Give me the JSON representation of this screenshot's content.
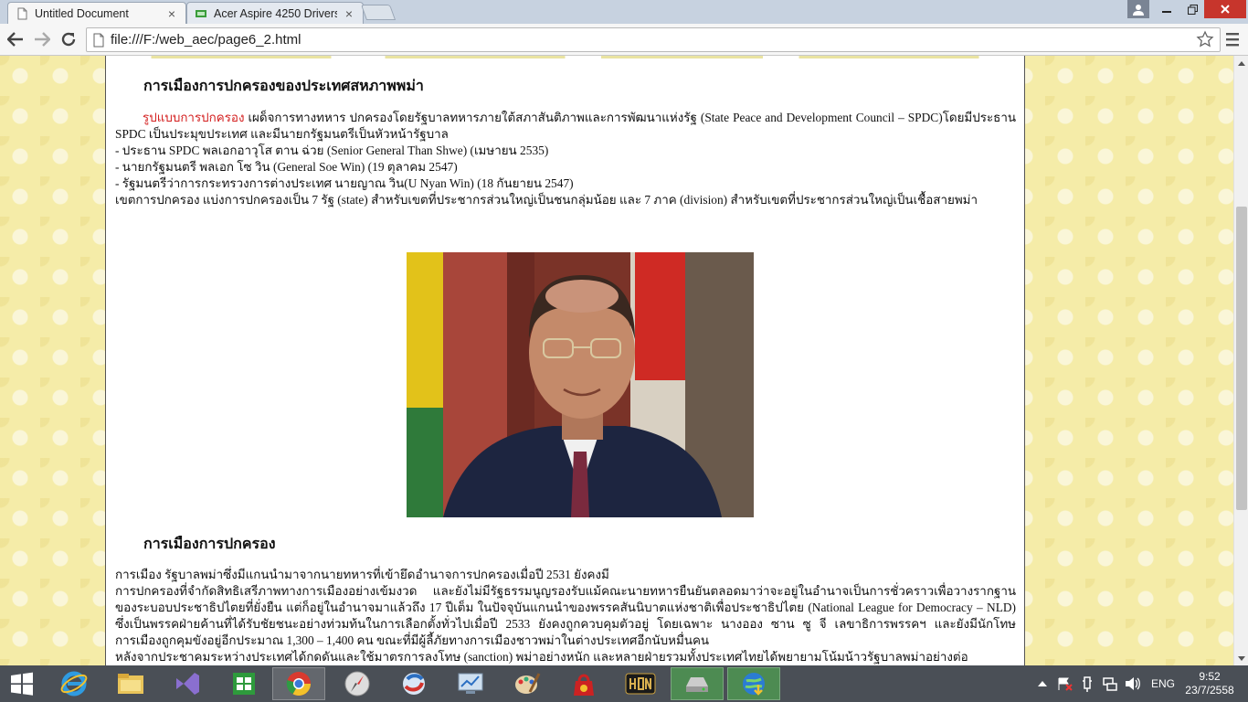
{
  "browser": {
    "tabs": [
      {
        "title": "Untitled Document",
        "active": true
      },
      {
        "title": "Acer Aspire 4250 Drivers D",
        "active": false
      }
    ],
    "url": "file:///F:/web_aec/page6_2.html"
  },
  "page": {
    "heading1": "การเมืองการปกครองของประเทศสหภาพพม่า",
    "gov_label": "รูปแบบการปกครอง",
    "gov_text": "เผด็จการทางทหาร ปกครองโดยรัฐบาลทหารภายใต้สภาสันติภาพและการพัฒนาแห่งรัฐ (State Peace and Development Council – SPDC)โดยมีประธาน SPDC เป็นประมุขประเทศ และมีนายกรัฐมนตรีเป็นหัวหน้ารัฐบาล",
    "bullets": [
      "- ประธาน SPDC พลเอกอาวุโส ตาน ฉ่วย (Senior General Than Shwe) (เมษายน 2535)",
      "- นายกรัฐมนตรี พลเอก โซ วิน (General Soe Win) (19 ตุลาคม 2547)",
      "- รัฐมนตรีว่าการกระทรวงการต่างประเทศ นายญาณ วิน(U Nyan Win) (18 กันยายน 2547)"
    ],
    "admin_text": "เขตการปกครอง แบ่งการปกครองเป็น 7 รัฐ (state) สำหรับเขตที่ประชากรส่วนใหญ่เป็นชนกลุ่มน้อย และ 7 ภาค (division) สำหรับเขตที่ประชากรส่วนใหญ่เป็นเชื้อสายพม่า",
    "heading2": "การเมืองการปกครอง",
    "politics_line1": "การเมือง รัฐบาลพม่าซึ่งมีแกนนำมาจากนายทหารที่เข้ายึดอำนาจการปกครองเมื่อปี 2531 ยังคงมี",
    "politics_para": "การปกครองที่จำกัดสิทธิเสรีภาพทางการเมืองอย่างเข้มงวด และยังไม่มีรัฐธรรมนูญรองรับแม้คณะนายทหารยืนยันตลอดมาว่าจะอยู่ในอำนาจเป็นการชั่วคราวเพื่อวางรากฐานของระบอบประชาธิปไตยที่ยั่งยืน แต่ก็อยู่ในอำนาจมาแล้วถึง 17 ปีเต็ม ในปัจจุบันแกนนำของพรรคสันนิบาตแห่งชาติเพื่อประชาธิปไตย (National League for Democracy – NLD) ซึ่งเป็นพรรคฝ่ายค้านที่ได้รับชัยชนะอย่างท่วมท้นในการเลือกตั้งทั่วไปเมื่อปี 2533 ยังคงถูกควบคุมตัวอยู่ โดยเฉพาะ นางออง ซาน ซู จี เลขาธิการพรรคฯ และยังมีนักโทษการเมืองถูกคุมขังอยู่อีกประมาณ 1,300 – 1,400 คน ขณะที่มีผู้ลี้ภัยทางการเมืองชาวพม่าในต่างประเทศอีกนับหมื่นคน",
    "politics_line_last": "หลังจากประชาคมระหว่างประเทศได้กดดันและใช้มาตรการลงโทษ (sanction) พม่าอย่างหนัก และหลายฝ่ายรวมทั้งประเทศไทยได้พยายามโน้มน้าวรัฐบาลพม่าอย่างต่อ"
  },
  "taskbar": {
    "language": "ENG",
    "time": "9:52",
    "date": "23/7/2558"
  },
  "colors": {
    "accent_red": "#d42020",
    "page_bg": "#f5eca8",
    "taskbar": "#4a4f56"
  }
}
